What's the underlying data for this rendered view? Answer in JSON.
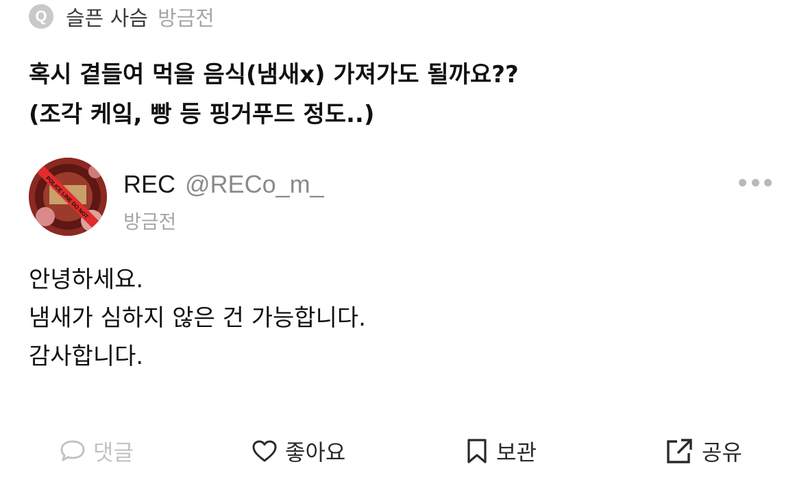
{
  "question": {
    "badge": "Q",
    "author": "슬픈 사슴",
    "time": "방금전",
    "lines": [
      "혹시 곁들여 먹을 음식(냄새x) 가져가도 될까요??",
      "(조각 케잌, 빵 등 핑거푸드 정도..)"
    ]
  },
  "answer": {
    "name": "REC",
    "handle": "@RECo_m_",
    "time": "방금전",
    "avatar_text": "POLICE LINE DO NOT",
    "lines": [
      "안녕하세요.",
      "냄새가 심하지 않은 건 가능합니다.",
      "감사합니다."
    ]
  },
  "actions": {
    "comment": "댓글",
    "like": "좋아요",
    "save": "보관",
    "share": "공유"
  },
  "icons": {
    "more": "more-dots-icon",
    "comment": "speech-bubble-icon",
    "like": "heart-icon",
    "save": "bookmark-icon",
    "share": "share-icon"
  },
  "colors": {
    "badge_bg": "#c9c9c9",
    "muted": "#a6a6a6",
    "text": "#111111",
    "disabled": "#c2c2c2"
  }
}
